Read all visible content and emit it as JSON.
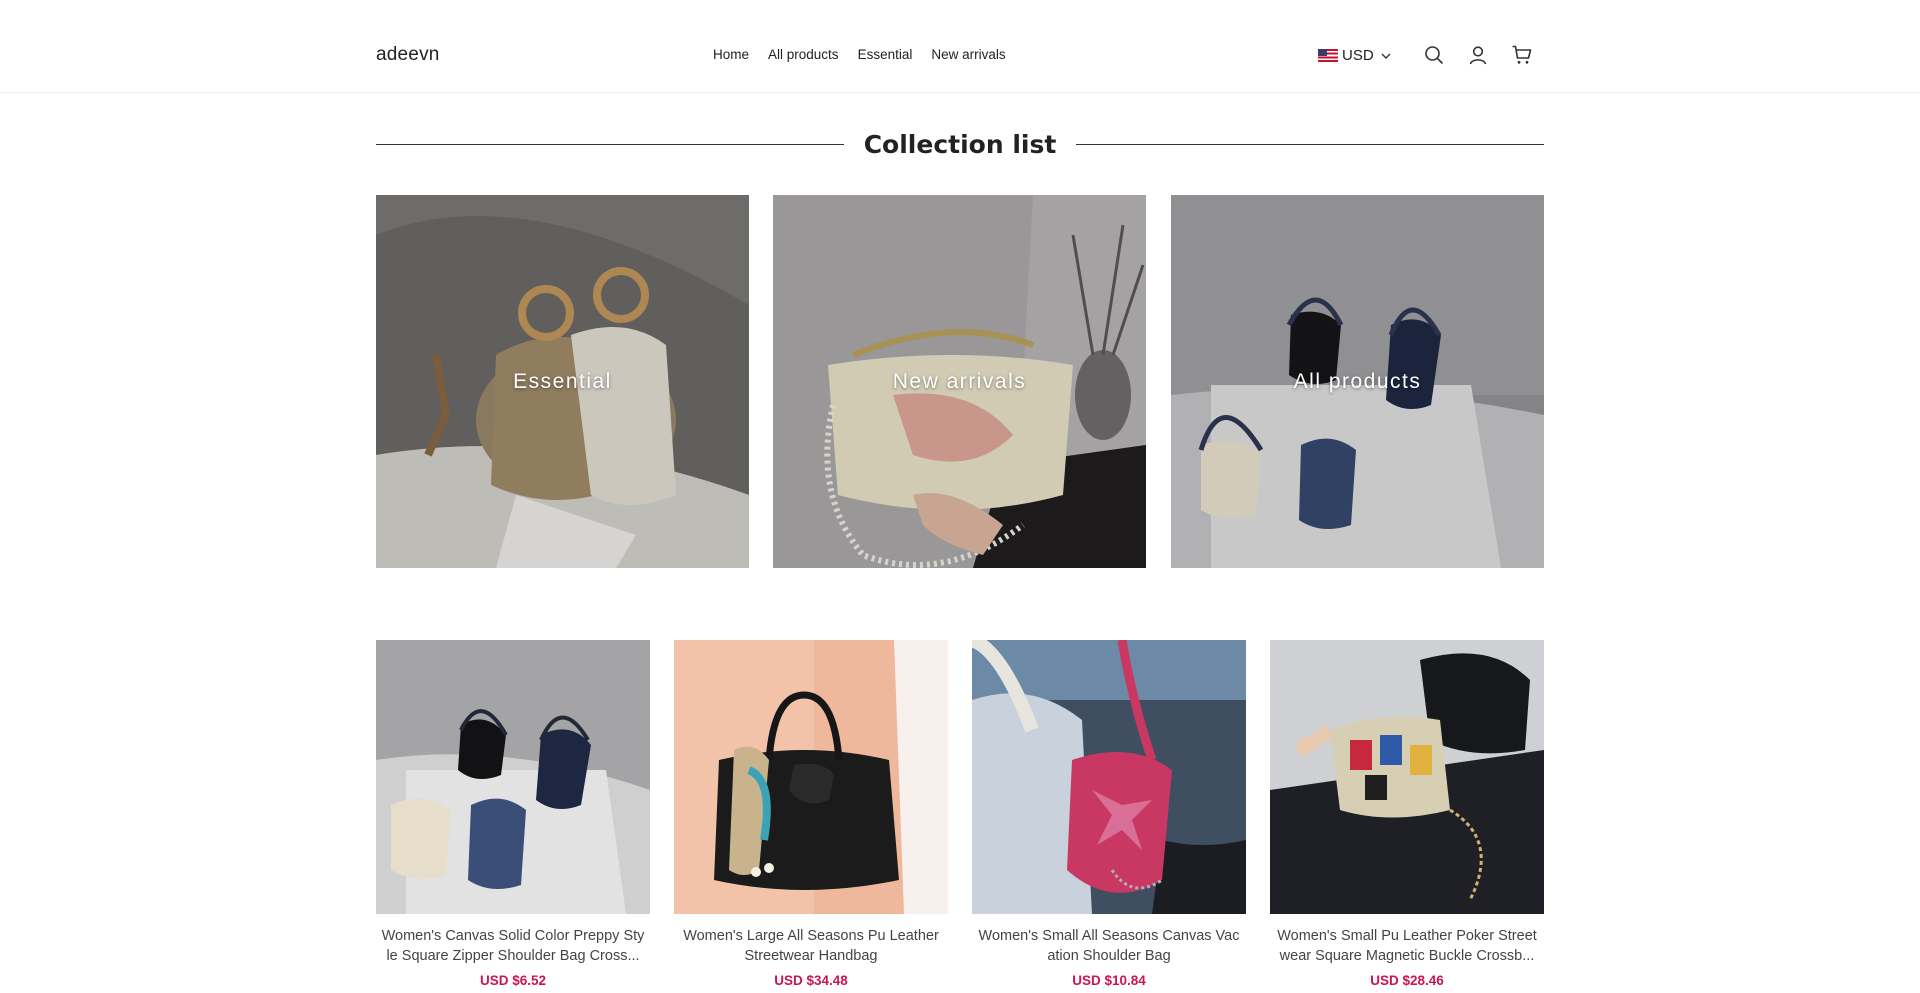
{
  "header": {
    "logo": "adeevn",
    "nav": [
      "Home",
      "All products",
      "Essential",
      "New arrivals"
    ],
    "currency": "USD"
  },
  "collection": {
    "title": "Collection list",
    "cards": [
      "Essential",
      "New arrivals",
      "All products"
    ]
  },
  "products": [
    {
      "name": "Women's Canvas Solid Color Preppy Style Square Zipper Shoulder Bag Cross...",
      "price": "USD $6.52"
    },
    {
      "name": "Women's Large All Seasons Pu Leather Streetwear Handbag",
      "price": "USD $34.48"
    },
    {
      "name": "Women's Small All Seasons Canvas Vacation Shoulder Bag",
      "price": "USD $10.84"
    },
    {
      "name": "Women's Small Pu Leather Poker Streetwear Square Magnetic Buckle Crossb...",
      "price": "USD $28.46"
    }
  ],
  "icons": {
    "search": "search-icon",
    "account": "account-icon",
    "cart": "cart-icon",
    "flag": "us-flag-icon",
    "chevron": "chevron-down-icon"
  },
  "colors": {
    "price": "#c9174f",
    "divider": "#333333"
  }
}
